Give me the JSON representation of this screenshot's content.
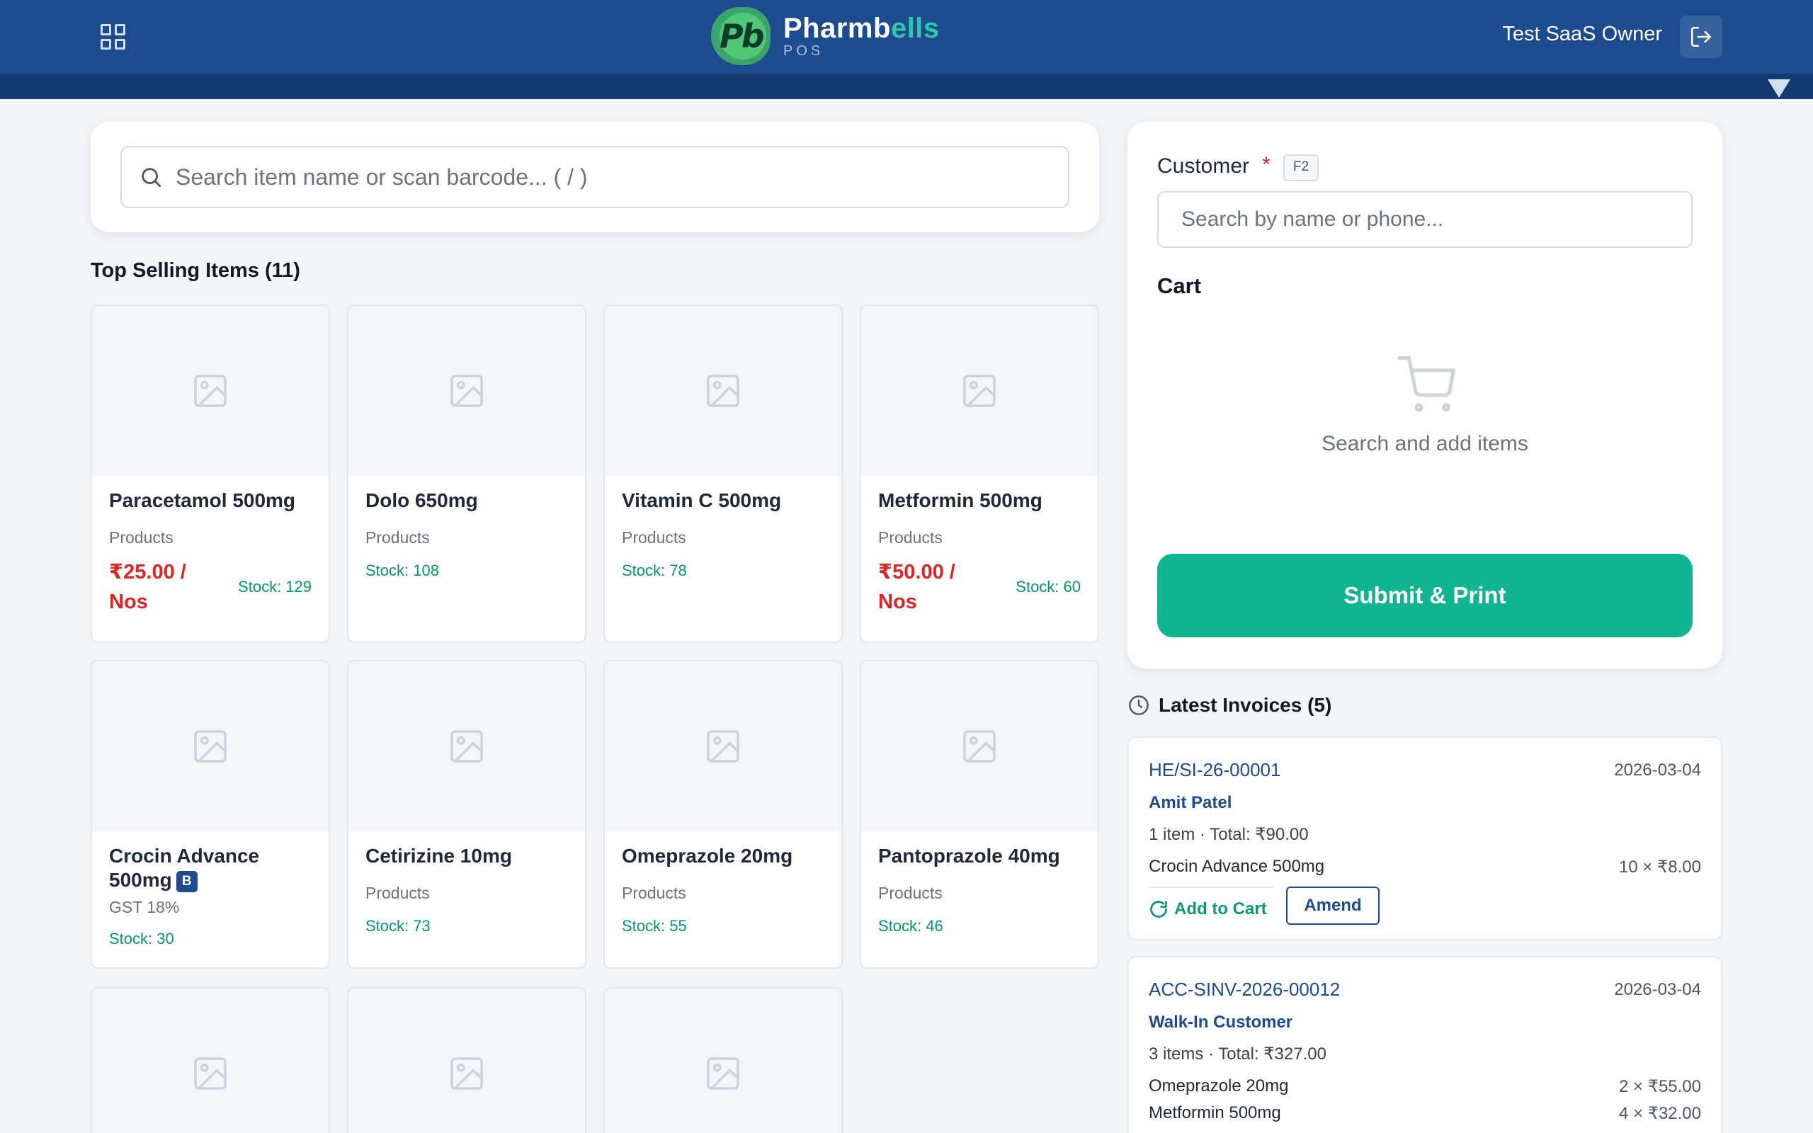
{
  "header": {
    "logo_mark": "Pb",
    "brand_main": "Pharmb",
    "brand_accent": "ells",
    "brand_sub": "POS",
    "user_name": "Test SaaS Owner"
  },
  "search": {
    "placeholder": "Search item name or scan barcode... ( / )"
  },
  "top_selling": {
    "title": "Top Selling Items (11)",
    "items": [
      {
        "name": "Paracetamol 500mg",
        "category": "Products",
        "price": "₹25.00 /",
        "unit": "Nos",
        "stock": "Stock: 129"
      },
      {
        "name": "Dolo 650mg",
        "category": "Products",
        "stock": "Stock: 108"
      },
      {
        "name": "Vitamin C 500mg",
        "category": "Products",
        "stock": "Stock: 78"
      },
      {
        "name": "Metformin 500mg",
        "category": "Products",
        "price": "₹50.00 /",
        "unit": "Nos",
        "stock": "Stock: 60"
      },
      {
        "name_line1": "Crocin Advance",
        "name_line2": "500mg",
        "badge": "B",
        "tax": "GST 18%",
        "stock": "Stock: 30"
      },
      {
        "name": "Cetirizine 10mg",
        "category": "Products",
        "stock": "Stock: 73"
      },
      {
        "name": "Omeprazole 20mg",
        "category": "Products",
        "stock": "Stock: 55"
      },
      {
        "name": "Pantoprazole 40mg",
        "category": "Products",
        "stock": "Stock: 46"
      }
    ]
  },
  "cart_panel": {
    "customer_label": "Customer",
    "required_mark": "*",
    "shortcut": "F2",
    "customer_placeholder": "Search by name or phone...",
    "cart_title": "Cart",
    "empty_text": "Search and add items",
    "submit_label": "Submit & Print"
  },
  "invoices": {
    "title": "Latest Invoices (5)",
    "list": [
      {
        "number": "HE/SI-26-00001",
        "date": "2026-03-04",
        "customer": "Amit Patel",
        "summary": "1 item · Total: ₹90.00",
        "lines": [
          {
            "item": "Crocin Advance 500mg",
            "qty": "10 × ₹8.00"
          }
        ],
        "add_to_cart": "Add to Cart",
        "amend": "Amend"
      },
      {
        "number": "ACC-SINV-2026-00012",
        "date": "2026-03-04",
        "customer": "Walk-In Customer",
        "summary": "3 items · Total: ₹327.00",
        "lines": [
          {
            "item": "Omeprazole 20mg",
            "qty": "2 × ₹55.00"
          },
          {
            "item": "Metformin 500mg",
            "qty": "4 × ₹32.00"
          }
        ]
      }
    ]
  },
  "colors": {
    "header_bg": "#1d4b8f",
    "accent_green": "#10b48e",
    "price_red": "#dc2626",
    "stock_green": "#059669"
  },
  "icons": [
    "apps-grid-icon",
    "logout-icon",
    "search-icon",
    "image-placeholder-icon",
    "cart-icon",
    "clock-icon",
    "refresh-icon",
    "collapse-arrow-icon"
  ]
}
